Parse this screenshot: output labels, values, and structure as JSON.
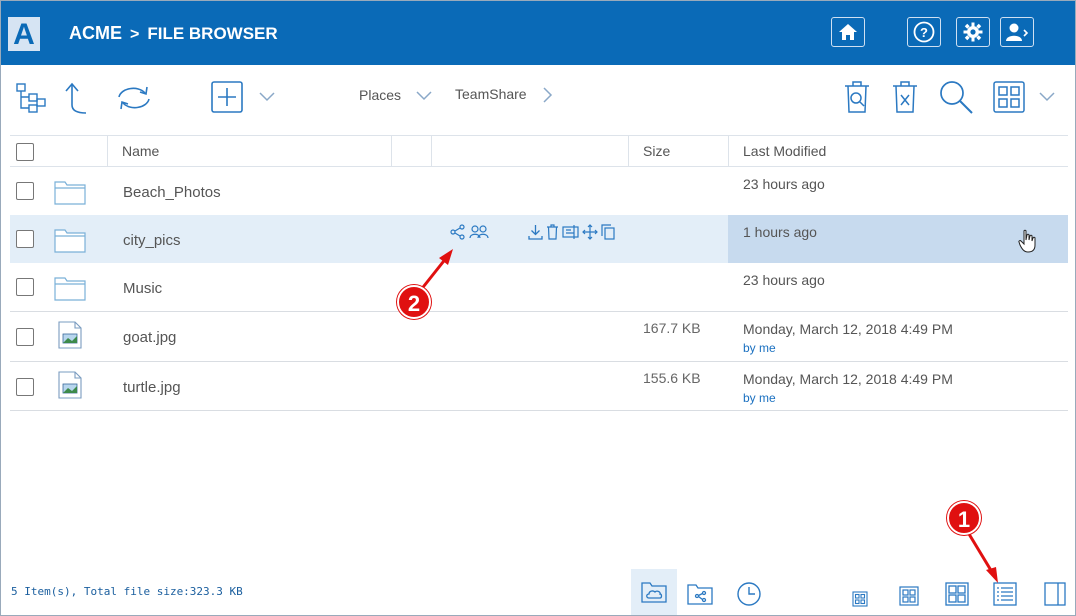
{
  "header": {
    "logo": "A",
    "brand": "ACME",
    "separator": ">",
    "section": "FILE BROWSER",
    "buttons": [
      "home-icon",
      "help-icon",
      "gear-icon",
      "user-icon"
    ]
  },
  "toolbar": {
    "tools": [
      "tree-view-icon",
      "up-arrow-icon",
      "refresh-icon",
      "add-icon",
      "chevron-down-icon"
    ],
    "places_label": "Places",
    "teamshare_label": "TeamShare",
    "right_tools": [
      "recycle-bin-icon",
      "delete-icon",
      "search-icon",
      "grid-view-icon",
      "chevron-down-icon"
    ]
  },
  "table": {
    "columns": {
      "name": "Name",
      "size": "Size",
      "modified": "Last Modified"
    },
    "rows": [
      {
        "type": "folder",
        "name": "Beach_Photos",
        "size": "",
        "modified": "23 hours ago",
        "by": ""
      },
      {
        "type": "folder",
        "name": "city_pics",
        "size": "",
        "modified": "1 hours ago",
        "by": "",
        "selected": true
      },
      {
        "type": "folder",
        "name": "Music",
        "size": "",
        "modified": "23 hours ago",
        "by": ""
      },
      {
        "type": "image",
        "name": "goat.jpg",
        "size": "167.7 KB",
        "modified": "Monday, March 12, 2018 4:49 PM",
        "by": "by me"
      },
      {
        "type": "image",
        "name": "turtle.jpg",
        "size": "155.6 KB",
        "modified": "Monday, March 12, 2018 4:49 PM",
        "by": "by me"
      }
    ],
    "row_actions": [
      "share-icon",
      "share-users-icon",
      "download-icon",
      "delete-icon",
      "rename-icon",
      "move-icon",
      "copy-icon"
    ]
  },
  "footer": {
    "status": "5 Item(s), Total file size:323.3 KB",
    "left_views": [
      "cloud-folder-icon",
      "shared-folder-icon",
      "recent-icon"
    ],
    "right_views": [
      "small-icons-view-icon",
      "medium-icons-view-icon",
      "large-icons-view-icon",
      "list-view-icon",
      "preview-pane-icon"
    ]
  },
  "annotations": {
    "badge_1": "1",
    "badge_2": "2"
  },
  "colors": {
    "header_bg": "#0a6ab7",
    "selected_row": "#e3eef8",
    "accent": "#1a70c0",
    "annotation_red": "#e01010"
  }
}
